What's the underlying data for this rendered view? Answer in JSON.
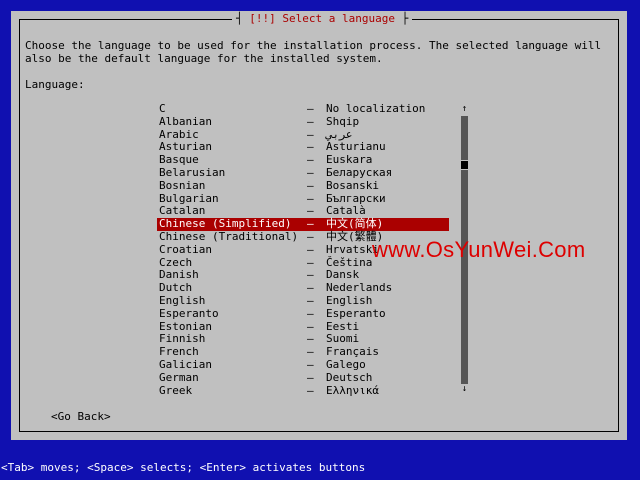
{
  "window": {
    "title": "Select a language",
    "title_prefix": "[!!]"
  },
  "intro_text": "Choose the language to be used for the installation process. The selected language will also be the default language for the installed system.",
  "language_label": "Language:",
  "languages": [
    {
      "name": "C",
      "sep": "–",
      "native": "No localization"
    },
    {
      "name": "Albanian",
      "sep": "–",
      "native": "Shqip"
    },
    {
      "name": "Arabic",
      "sep": "–",
      "native": "عربي"
    },
    {
      "name": "Asturian",
      "sep": "–",
      "native": "Asturianu"
    },
    {
      "name": "Basque",
      "sep": "–",
      "native": "Euskara"
    },
    {
      "name": "Belarusian",
      "sep": "–",
      "native": "Беларуская"
    },
    {
      "name": "Bosnian",
      "sep": "–",
      "native": "Bosanski"
    },
    {
      "name": "Bulgarian",
      "sep": "–",
      "native": "Български"
    },
    {
      "name": "Catalan",
      "sep": "–",
      "native": "Català"
    },
    {
      "name": "Chinese (Simplified)",
      "sep": "–",
      "native": "中文(简体)",
      "selected": true
    },
    {
      "name": "Chinese (Traditional)",
      "sep": "–",
      "native": "中文(繁體)"
    },
    {
      "name": "Croatian",
      "sep": "–",
      "native": "Hrvatski"
    },
    {
      "name": "Czech",
      "sep": "–",
      "native": "Čeština"
    },
    {
      "name": "Danish",
      "sep": "–",
      "native": "Dansk"
    },
    {
      "name": "Dutch",
      "sep": "–",
      "native": "Nederlands"
    },
    {
      "name": "English",
      "sep": "–",
      "native": "English"
    },
    {
      "name": "Esperanto",
      "sep": "–",
      "native": "Esperanto"
    },
    {
      "name": "Estonian",
      "sep": "–",
      "native": "Eesti"
    },
    {
      "name": "Finnish",
      "sep": "–",
      "native": "Suomi"
    },
    {
      "name": "French",
      "sep": "–",
      "native": "Français"
    },
    {
      "name": "Galician",
      "sep": "–",
      "native": "Galego"
    },
    {
      "name": "German",
      "sep": "–",
      "native": "Deutsch"
    },
    {
      "name": "Greek",
      "sep": "–",
      "native": "Ελληνικά"
    }
  ],
  "scrollbar": {
    "up_arrow": "↑",
    "down_arrow": "↓",
    "position_fraction": 0.17
  },
  "watermark": "www.OsYunWei.Com",
  "buttons": {
    "go_back": "<Go Back>"
  },
  "status_bar": "<Tab> moves; <Space> selects; <Enter> activates buttons",
  "colors": {
    "background": "#1010b0",
    "dialog": "#c0c0c0",
    "highlight": "#aa0000",
    "title": "#aa0000",
    "watermark": "#dd0000"
  }
}
